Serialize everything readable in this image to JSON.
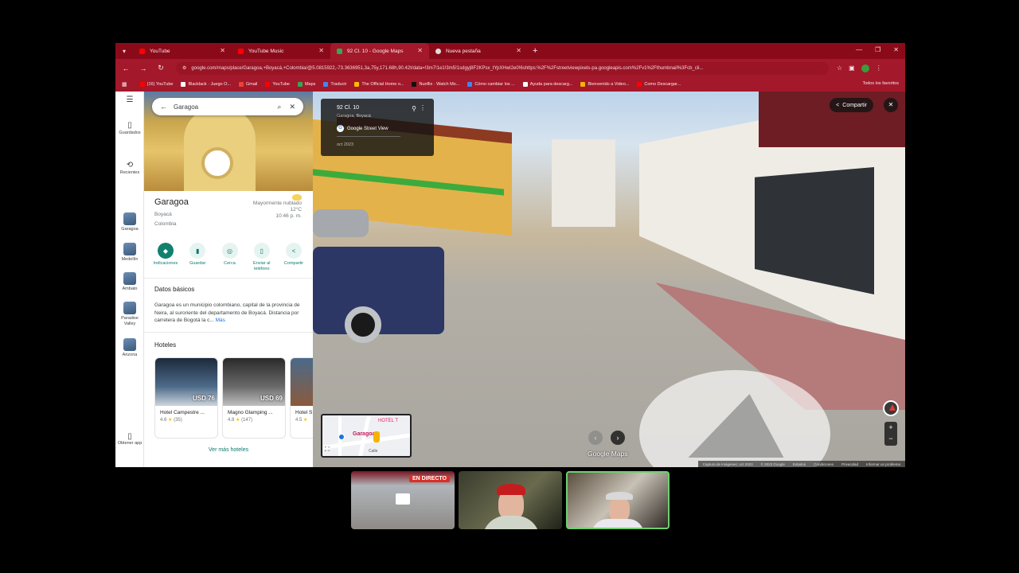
{
  "browser": {
    "tabs": [
      {
        "title": "YouTube",
        "favicon_color": "#ff0000",
        "active": false
      },
      {
        "title": "YouTube Music",
        "favicon_color": "#ff0000",
        "active": false
      },
      {
        "title": "92 Cl. 10 - Google Maps",
        "favicon_color": "#34a853",
        "active": true
      },
      {
        "title": "Nueva pestaña",
        "favicon_color": "#dddddd",
        "active": false
      }
    ],
    "url": "google.com/maps/place/Garagoa,+Boyacá,+Colombia/@5.0815922,-73.3636951,3a,75y,171.68h,90.42t/data=!3m7!1e1!3m5!1sdgyj8F2KPsx_tYpXHwI2e0!6shttps:%2F%2Fstreetviewpixels-pa.googleapis.com%2Fv1%2Fthumbnail%3Fcb_cli...",
    "bookmarks": [
      {
        "label": "(16) YouTube",
        "color": "#ff0000"
      },
      {
        "label": "Blacklack · Juego O...",
        "color": "#ffffff"
      },
      {
        "label": "Gmail",
        "color": "#ea4335"
      },
      {
        "label": "YouTube",
        "color": "#ff0000"
      },
      {
        "label": "Maps",
        "color": "#34a853"
      },
      {
        "label": "Traducir",
        "color": "#4285f4"
      },
      {
        "label": "The Official Home o...",
        "color": "#fbbc04"
      },
      {
        "label": "Nunflix · Watch Mo...",
        "color": "#111111"
      },
      {
        "label": "Cómo cambiar los ...",
        "color": "#4285f4"
      },
      {
        "label": "Ayuda para descarg...",
        "color": "#ffffff"
      },
      {
        "label": "Bienvenido a Video...",
        "color": "#f4b400"
      },
      {
        "label": "Como Descargar...",
        "color": "#ff0000"
      }
    ],
    "all_bookmarks": "Todos los favoritos",
    "accent": "#a3182a"
  },
  "rail": {
    "saved": "Guardados",
    "recent": "Recientes",
    "places": [
      "Garagoa",
      "Medellín",
      "Ambato",
      "Paradise Valley",
      "Arizona"
    ],
    "get_app": "Obtener app"
  },
  "panel": {
    "search_value": "Garagoa",
    "title": "Garagoa",
    "region": "Boyacá",
    "country": "Colombia",
    "weather": {
      "condition": "Mayormente nublado",
      "temp": "12°C",
      "time": "10:46 p. m."
    },
    "actions": [
      "Indicaciones",
      "Guardar",
      "Cerca",
      "Enviar al teléfono",
      "Compartir"
    ],
    "about_title": "Datos básicos",
    "about_text": "Garagoa es un municipio colombiano, capital de la provincia de Neira, al suroriente del departamento de Boyacá. Distancia por carretera de Bogotá la c...",
    "about_more": "Más",
    "hotels_title": "Hoteles",
    "hotels": [
      {
        "name": "Hotel Campestre ...",
        "price": "USD 76",
        "rating": "4.6",
        "reviews": "(35)"
      },
      {
        "name": "Magno Glamping ...",
        "price": "USD 69",
        "rating": "4.8",
        "reviews": "(147)"
      },
      {
        "name": "Hotel S...",
        "price": "",
        "rating": "4.5",
        "reviews": ""
      }
    ],
    "more_hotels": "Ver más hoteles"
  },
  "streetview": {
    "address": "92 Cl. 10",
    "sub": "Garagoa, Boyacá",
    "source": "Google Street View",
    "date": "oct 2023",
    "share": "Compartir",
    "logo": "Google Maps",
    "minimap_label": "Garagoa",
    "minimap_hotel": "HOTEL T",
    "minimap_street": "Calle",
    "footer": [
      "Captura de imágenes: oct 2023",
      "© 2023 Google",
      "Estados",
      "Condiciones",
      "Privacidad",
      "Informar un problema"
    ]
  },
  "call": {
    "live_badge": "EN DIRECTO"
  }
}
